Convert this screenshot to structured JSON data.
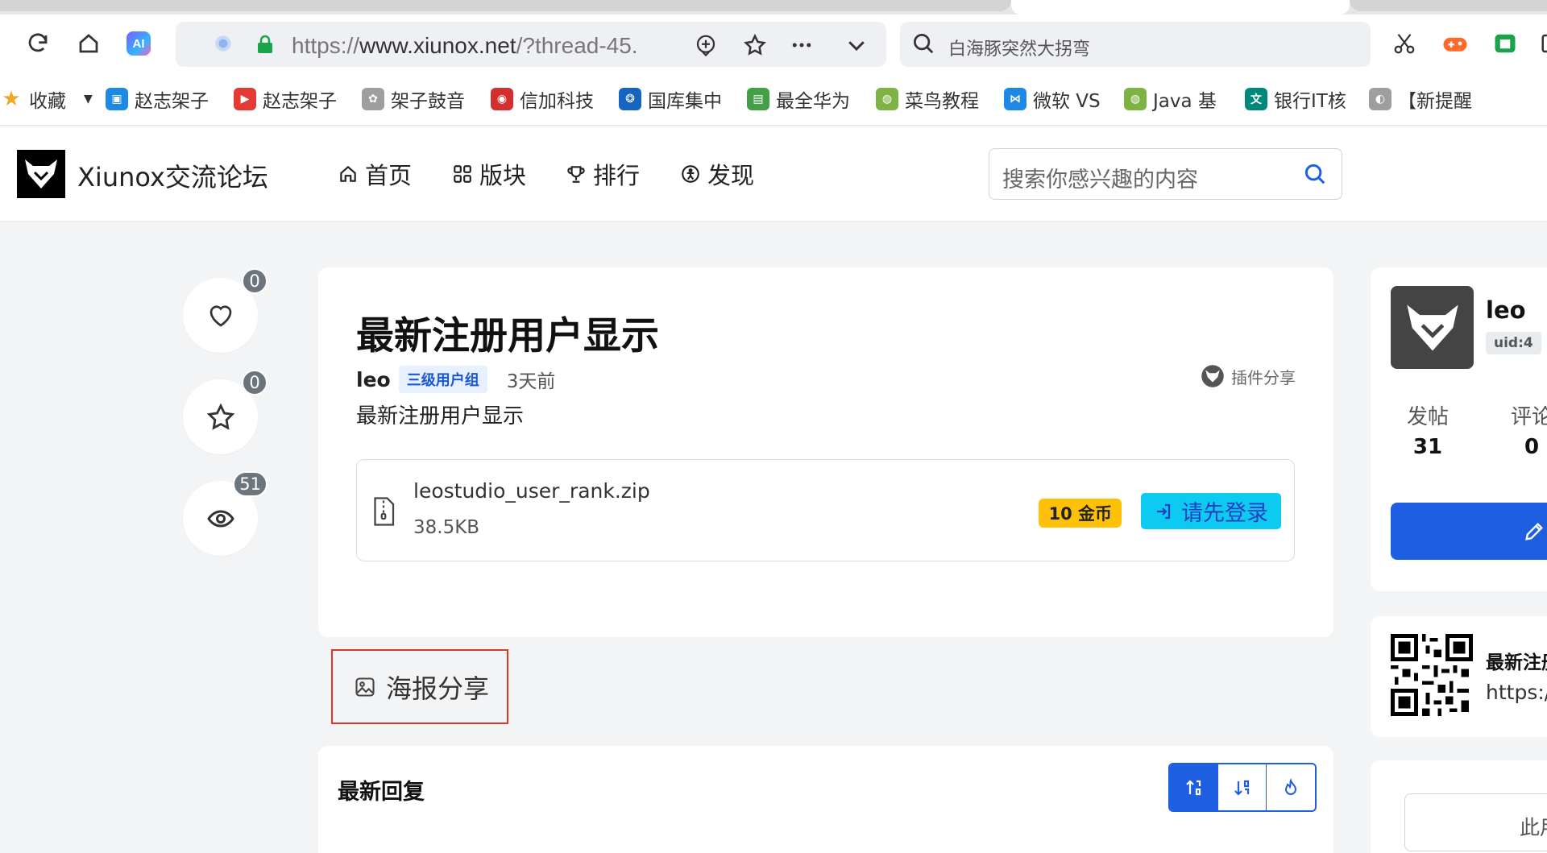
{
  "browser": {
    "url_prefix": "https://",
    "url_domain": "www.xiunox.net",
    "url_path": "/?thread-45.",
    "search_text": "白海豚突然大拐弯",
    "bookmarks": [
      {
        "label": "收藏",
        "color": "#f5a623",
        "icon": "star-icon"
      },
      {
        "label": "赵志架子",
        "color": "#1e88e5",
        "icon": "bilibili-icon"
      },
      {
        "label": "赵志架子",
        "color": "#e53935",
        "icon": "youku-icon"
      },
      {
        "label": "架子鼓音",
        "color": "#9e9e9e",
        "icon": "gear-icon"
      },
      {
        "label": "信加科技",
        "color": "#d32f2f",
        "icon": "brand-icon"
      },
      {
        "label": "国库集中",
        "color": "#1565c0",
        "icon": "paw-icon"
      },
      {
        "label": "最全华为",
        "color": "#43a047",
        "icon": "iqiyi-icon"
      },
      {
        "label": "菜鸟教程",
        "color": "#7cb342",
        "icon": "runoob-icon"
      },
      {
        "label": "微软 VS",
        "color": "#1e88e5",
        "icon": "vs-icon"
      },
      {
        "label": "Java 基",
        "color": "#7cb342",
        "icon": "runoob-icon"
      },
      {
        "label": "银行IT核",
        "color": "#00897b",
        "icon": "translate-icon"
      },
      {
        "label": "【新提醒",
        "color": "#9e9e9e",
        "icon": "globe-icon"
      }
    ]
  },
  "site": {
    "name": "Xiunox交流论坛",
    "nav": [
      {
        "label": "首页",
        "icon": "home-icon"
      },
      {
        "label": "版块",
        "icon": "grid-icon"
      },
      {
        "label": "排行",
        "icon": "trophy-icon"
      },
      {
        "label": "发现",
        "icon": "compass-icon"
      }
    ],
    "search_placeholder": "搜索你感兴趣的内容"
  },
  "actions": {
    "like_count": "0",
    "favorite_count": "0",
    "view_count": "51"
  },
  "post": {
    "title": "最新注册用户显示",
    "author": "leo",
    "group": "三级用户组",
    "time": "3天前",
    "forum": "插件分享",
    "body": "最新注册用户显示",
    "attachment": {
      "filename": "leostudio_user_rank.zip",
      "size": "38.5KB",
      "price": "10 金币",
      "login_label": "请先登录"
    }
  },
  "poster_share": "海报分享",
  "replies": {
    "title": "最新回复"
  },
  "sidebar": {
    "user": {
      "name": "leo",
      "uid": "uid:4",
      "stats": [
        {
          "label": "发帖",
          "value": "31"
        },
        {
          "label": "评论",
          "value": "0"
        }
      ]
    },
    "share": {
      "title": "最新注册",
      "url": "https://"
    },
    "box_text": "此用"
  },
  "colors": {
    "primary": "#1d5fe0",
    "info": "#0dcaf0",
    "warning": "#ffc107",
    "highlight_border": "#e0342c"
  }
}
